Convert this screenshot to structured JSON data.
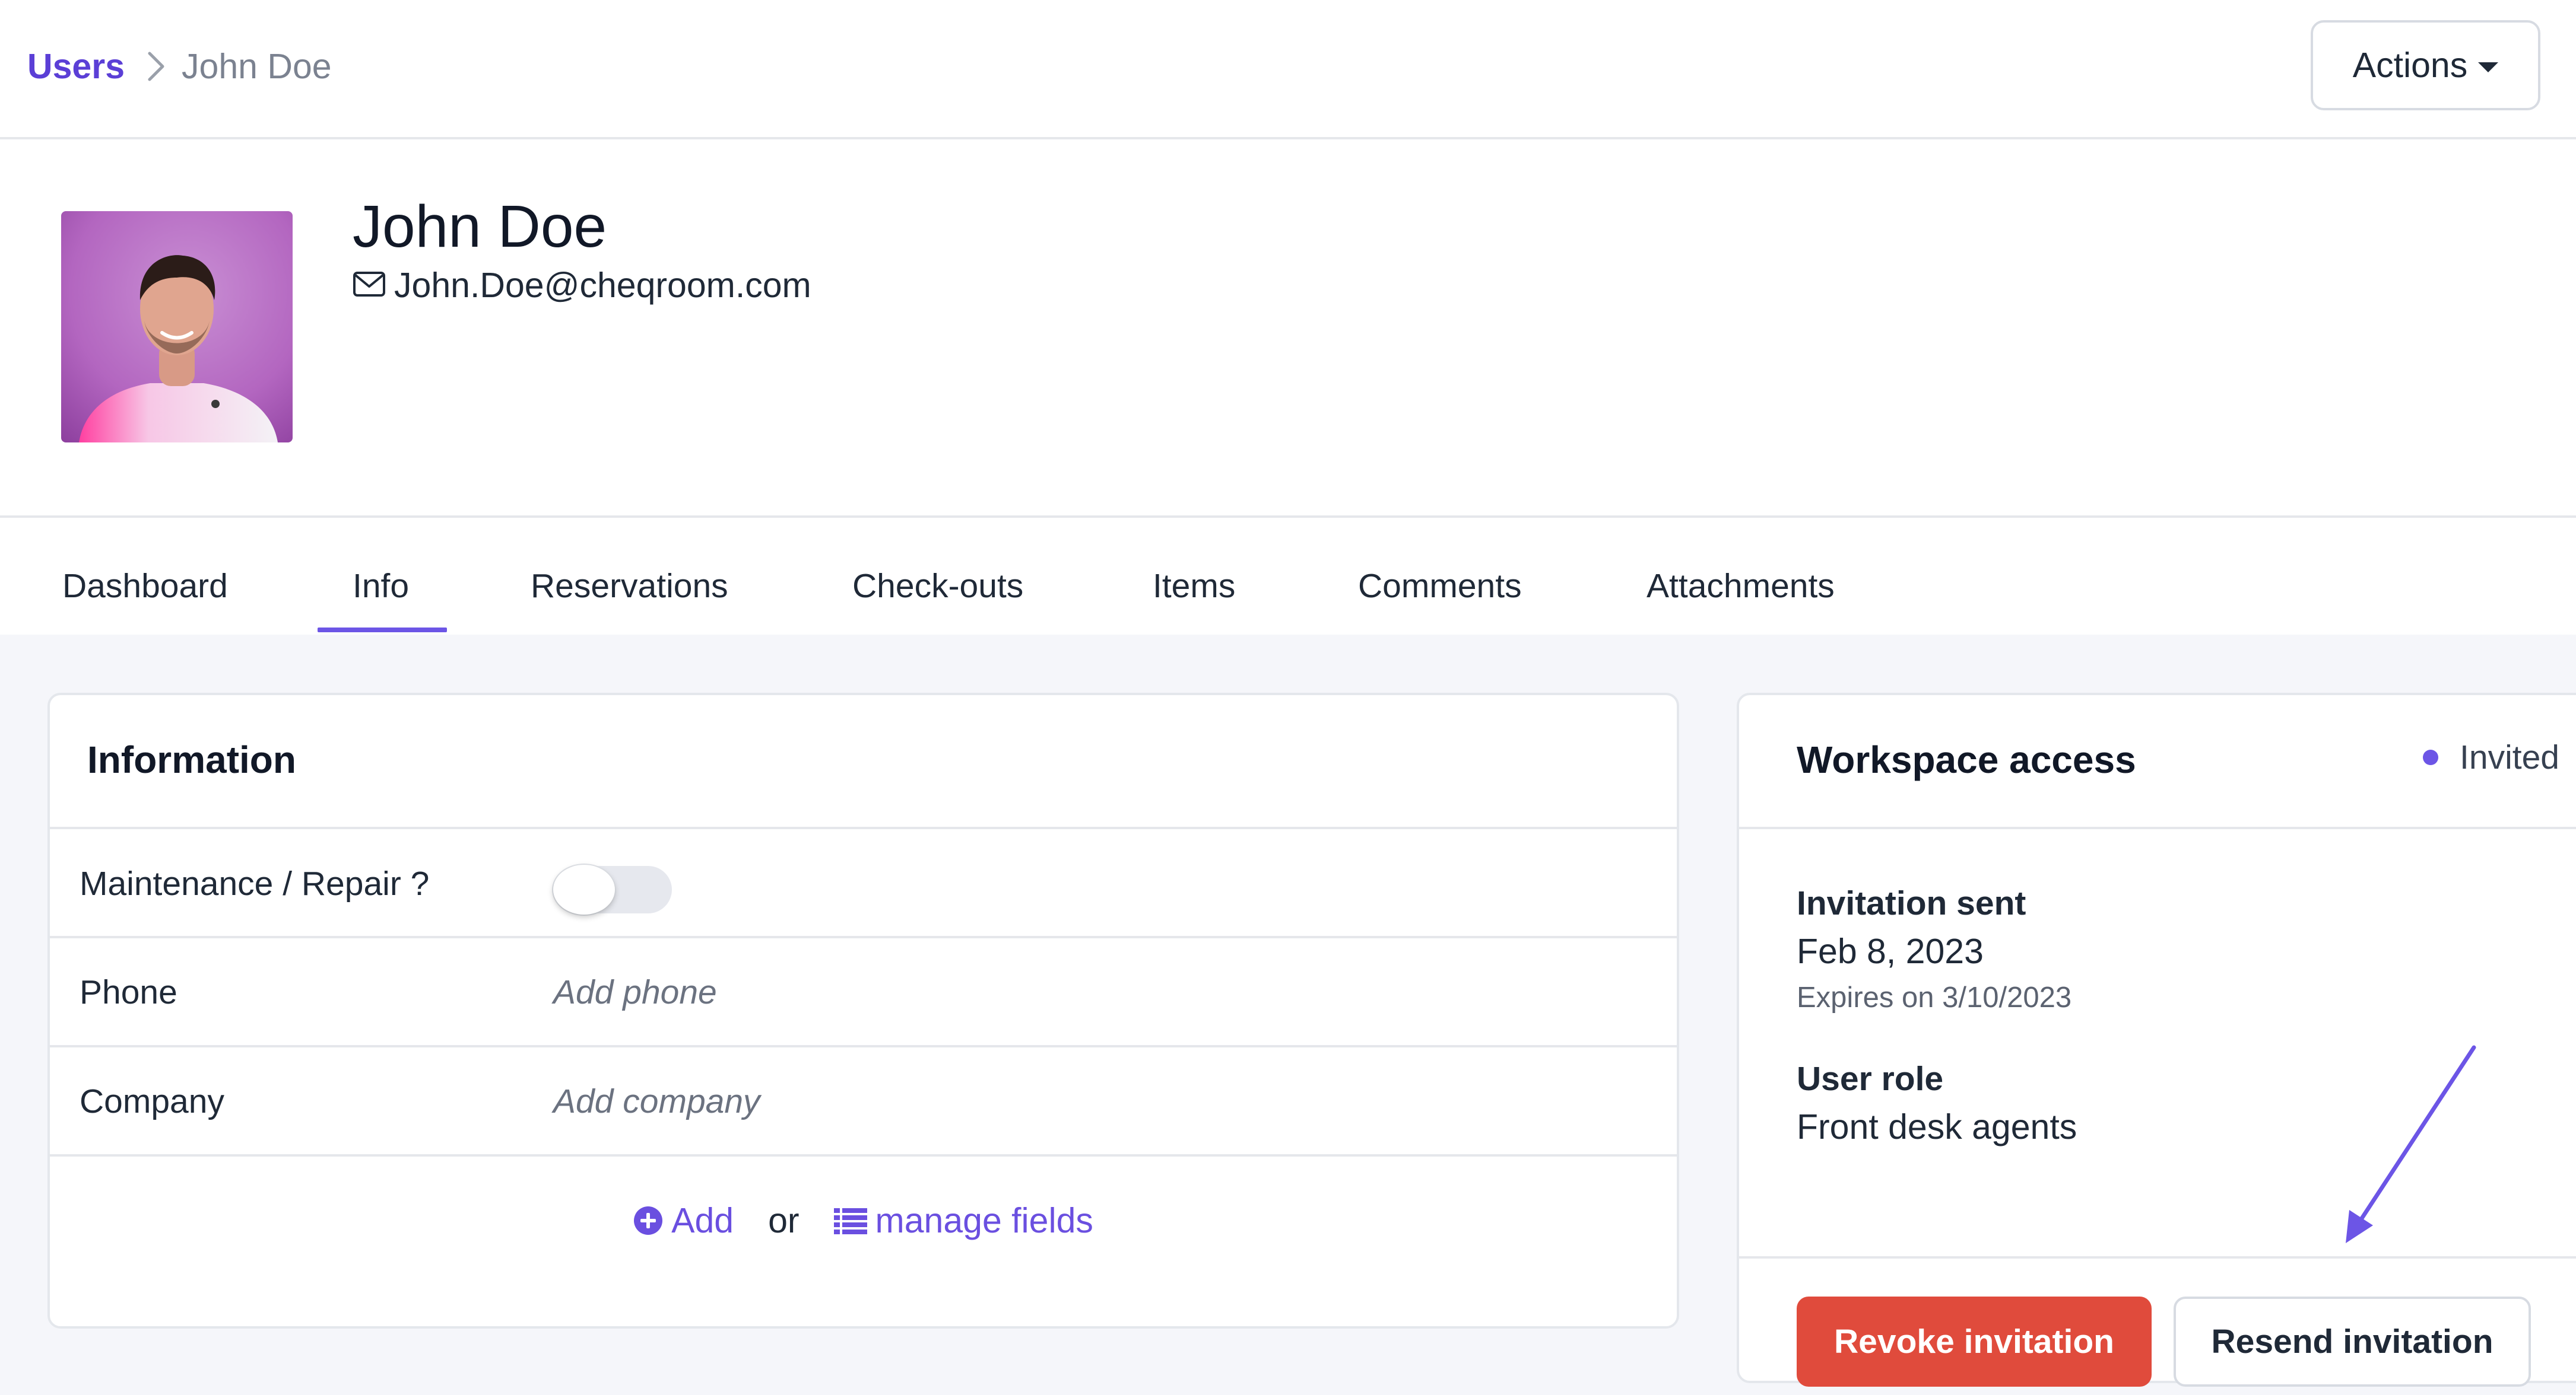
{
  "breadcrumb": {
    "root": "Users",
    "current": "John Doe"
  },
  "header": {
    "actions_label": "Actions"
  },
  "profile": {
    "name": "John Doe",
    "email": "John.Doe@cheqroom.com"
  },
  "tabs": [
    {
      "label": "Dashboard"
    },
    {
      "label": "Info",
      "active": true
    },
    {
      "label": "Reservations"
    },
    {
      "label": "Check-outs"
    },
    {
      "label": "Items"
    },
    {
      "label": "Comments"
    },
    {
      "label": "Attachments"
    }
  ],
  "information": {
    "title": "Information",
    "fields": [
      {
        "label": "Maintenance / Repair ?",
        "type": "toggle",
        "checked": false
      },
      {
        "label": "Phone",
        "placeholder": "Add phone"
      },
      {
        "label": "Company",
        "placeholder": "Add company"
      }
    ],
    "add_label": "Add",
    "or_text": "or",
    "manage_label": "manage fields"
  },
  "workspace": {
    "title": "Workspace access",
    "status": "Invited",
    "invitation_label": "Invitation sent",
    "invitation_date": "Feb 8, 2023",
    "expires": "Expires on 3/10/2023",
    "role_label": "User role",
    "role_value": "Front desk agents",
    "revoke_label": "Revoke invitation",
    "resend_label": "Resend invitation"
  },
  "colors": {
    "accent": "#6c55e6",
    "link": "#5b3fd6",
    "danger": "#e04b3c",
    "content_bg": "#f5f6fa"
  },
  "icons": {
    "breadcrumb_separator": "chevron-right-icon",
    "email": "envelope-icon",
    "actions_caret": "caret-down-icon",
    "add": "plus-circle-icon",
    "manage_fields": "list-icon",
    "annotation": "arrow-icon"
  }
}
